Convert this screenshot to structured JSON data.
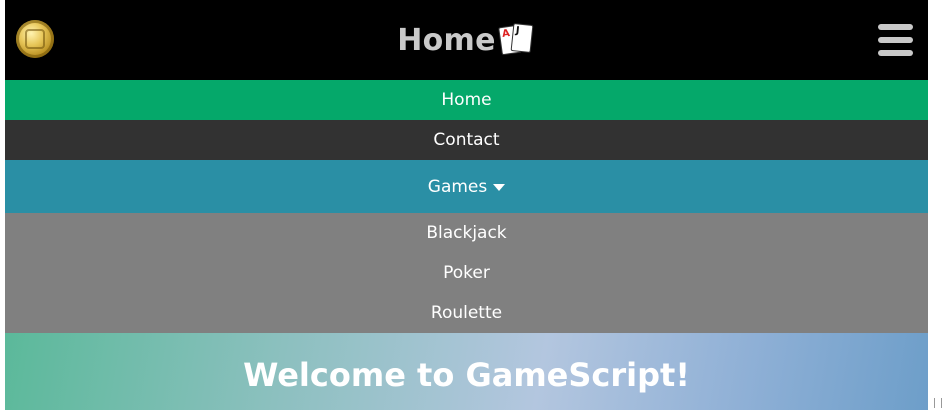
{
  "header": {
    "logo_icon": "gold-coin-icon",
    "title": "Home",
    "title_icon": "playing-cards-icon",
    "cards": {
      "ace": "A",
      "jack": "J"
    },
    "menu_icon": "hamburger-menu-icon"
  },
  "nav": {
    "home": "Home",
    "contact": "Contact",
    "games": "Games",
    "games_icon": "caret-down-icon",
    "games_submenu": [
      "Blackjack",
      "Poker",
      "Roulette"
    ]
  },
  "hero": {
    "title": "Welcome to GameScript!"
  },
  "colors": {
    "header_bg": "#000000",
    "home_bg": "#05a86a",
    "contact_bg": "#323232",
    "games_bg": "#2a8fa5",
    "dropdown_bg": "#808080",
    "title_text": "#c9c9c9"
  }
}
